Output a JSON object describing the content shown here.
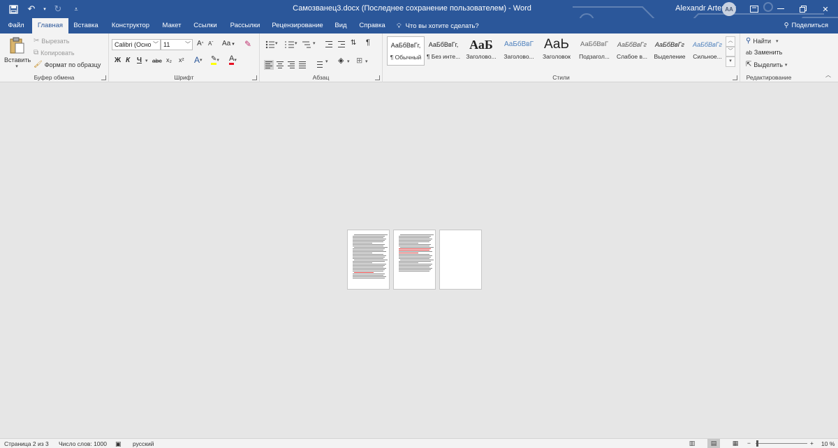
{
  "titlebar": {
    "title": "Самозванец3.docx (Последнее сохранение пользователем)  -  Word",
    "user_name": "Alexandr Artemev",
    "avatar_initials": "AA",
    "accent_color": "#2b579a",
    "qat": {
      "save_icon": "save-icon",
      "undo_icon": "undo-icon",
      "redo_icon": "redo-icon",
      "customize_icon": "customize-qat-icon"
    }
  },
  "tabs": [
    "Файл",
    "Главная",
    "Вставка",
    "Конструктор",
    "Макет",
    "Ссылки",
    "Рассылки",
    "Рецензирование",
    "Вид",
    "Справка"
  ],
  "active_tab": "Главная",
  "tell_me": "Что вы хотите сделать?",
  "share": "Поделиться",
  "ribbon": {
    "clipboard": {
      "paste": "Вставить",
      "cut": "Вырезать",
      "copy": "Копировать",
      "format_painter": "Формат по образцу",
      "label": "Буфер обмена"
    },
    "font": {
      "family": "Calibri (Осно",
      "size": "11",
      "label": "Шрифт",
      "change_case": "Aa",
      "bold": "Ж",
      "italic": "К",
      "underline": "Ч",
      "strike": "abc",
      "subscript": "x₂",
      "superscript": "x²",
      "grow": "A",
      "shrink": "A",
      "text_effects": "A",
      "font_color": "A"
    },
    "paragraph": {
      "label": "Абзац",
      "pilcrow": "¶"
    },
    "styles": {
      "label": "Стили",
      "items": [
        {
          "sample": "АаБбВвГг,",
          "name": "¶ Обычный"
        },
        {
          "sample": "АаБбВвГг,",
          "name": "¶ Без инте..."
        },
        {
          "sample": "АаБ",
          "name": "Заголово..."
        },
        {
          "sample": "АаБбВвГ",
          "name": "Заголово..."
        },
        {
          "sample": "АаЬ",
          "name": "Заголовок"
        },
        {
          "sample": "АаБбВвГ",
          "name": "Подзагол..."
        },
        {
          "sample": "АаБбВвГг",
          "name": "Слабое в..."
        },
        {
          "sample": "АаБбВвГг",
          "name": "Выделение"
        },
        {
          "sample": "АаБбВвГг",
          "name": "Сильное..."
        }
      ]
    },
    "editing": {
      "find": "Найти",
      "replace": "Заменить",
      "select": "Выделить",
      "label": "Редактирование"
    }
  },
  "statusbar": {
    "page": "Страница 2 из 3",
    "words": "Число слов: 1000",
    "language": "русский",
    "zoom": "10 %",
    "zoom_value": 10
  }
}
